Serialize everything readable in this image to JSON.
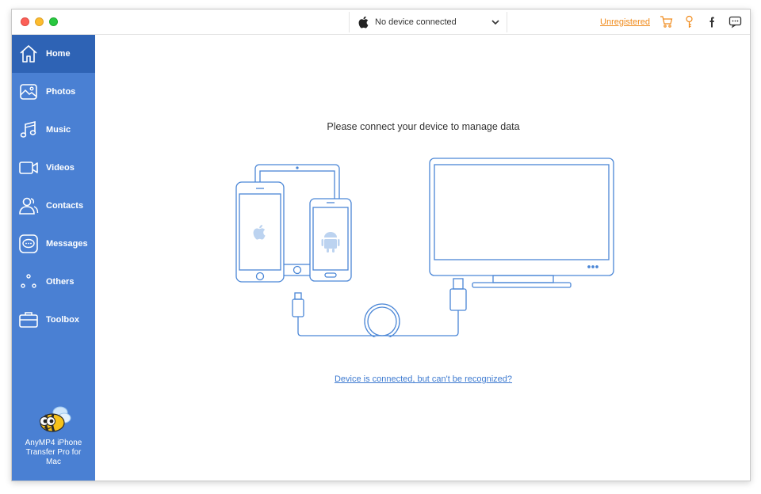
{
  "titlebar": {
    "device_selector": "No device connected",
    "unregistered_label": "Unregistered"
  },
  "sidebar": {
    "items": [
      {
        "label": "Home",
        "icon": "home-icon",
        "active": true
      },
      {
        "label": "Photos",
        "icon": "photos-icon",
        "active": false
      },
      {
        "label": "Music",
        "icon": "music-icon",
        "active": false
      },
      {
        "label": "Videos",
        "icon": "videos-icon",
        "active": false
      },
      {
        "label": "Contacts",
        "icon": "contacts-icon",
        "active": false
      },
      {
        "label": "Messages",
        "icon": "messages-icon",
        "active": false
      },
      {
        "label": "Others",
        "icon": "others-icon",
        "active": false
      },
      {
        "label": "Toolbox",
        "icon": "toolbox-icon",
        "active": false
      }
    ],
    "brand_name": "AnyMP4 iPhone Transfer Pro for Mac"
  },
  "main": {
    "prompt": "Please connect your device to manage data",
    "help_link": "Device is connected, but can't be recognized?"
  },
  "colors": {
    "sidebar": "#4a80d3",
    "sidebar_active": "#2e63b5",
    "accent_link": "#3d7ad0",
    "unregistered": "#f08a1a",
    "illustration_stroke": "#4a86d6"
  }
}
